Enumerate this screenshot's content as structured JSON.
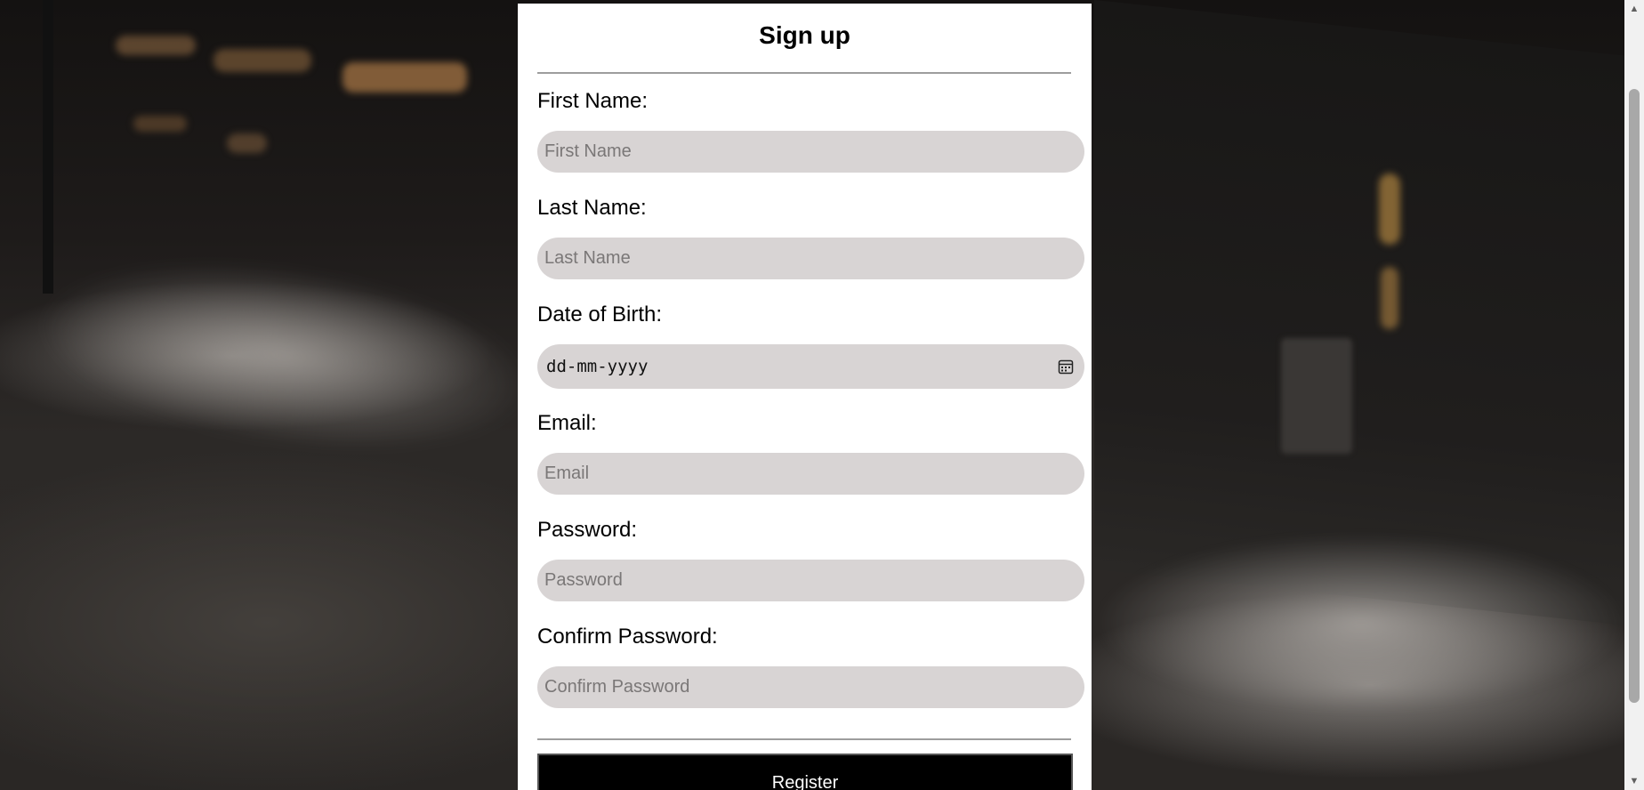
{
  "form": {
    "title": "Sign up",
    "fields": [
      {
        "label": "First Name:",
        "placeholder": "First Name",
        "type": "text"
      },
      {
        "label": "Last Name:",
        "placeholder": "Last Name",
        "type": "text"
      },
      {
        "label": "Date of Birth:",
        "placeholder": "dd-mm-yyyy",
        "type": "date"
      },
      {
        "label": "Email:",
        "placeholder": "Email",
        "type": "email"
      },
      {
        "label": "Password:",
        "placeholder": "Password",
        "type": "password"
      },
      {
        "label": "Confirm Password:",
        "placeholder": "Confirm Password",
        "type": "password"
      }
    ],
    "submit_label": "Register"
  },
  "icons": {
    "date_picker": "calendar-icon",
    "scroll_up": "triangle-up-icon",
    "scroll_down": "triangle-down-icon"
  },
  "colors": {
    "panel_background": "#ffffff",
    "input_background": "#d8d4d4",
    "button_background": "#000000",
    "button_text": "#ffffff",
    "divider": "#9d9d9d"
  }
}
